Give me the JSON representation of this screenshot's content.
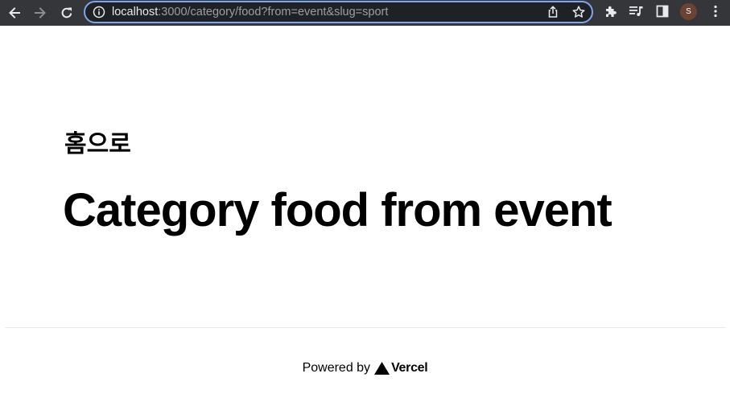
{
  "browser": {
    "url_host": "localhost",
    "url_rest": ":3000/category/food?from=event&slug=sport",
    "profile_initial": "S",
    "colors": {
      "toolbar_bg": "#35363a",
      "omnibox_bg": "#202124",
      "omnibox_border": "#7ca6ee",
      "avatar_bg": "#6b4233"
    },
    "icons": [
      "back-icon",
      "forward-icon",
      "reload-icon",
      "info-icon",
      "share-icon",
      "star-icon",
      "extensions-icon",
      "media-control-icon",
      "side-panel-icon",
      "menu-icon"
    ]
  },
  "page": {
    "home_link": "홈으로",
    "title": "Category food from event"
  },
  "footer": {
    "powered_by": "Powered by",
    "vercel": "Vercel"
  }
}
